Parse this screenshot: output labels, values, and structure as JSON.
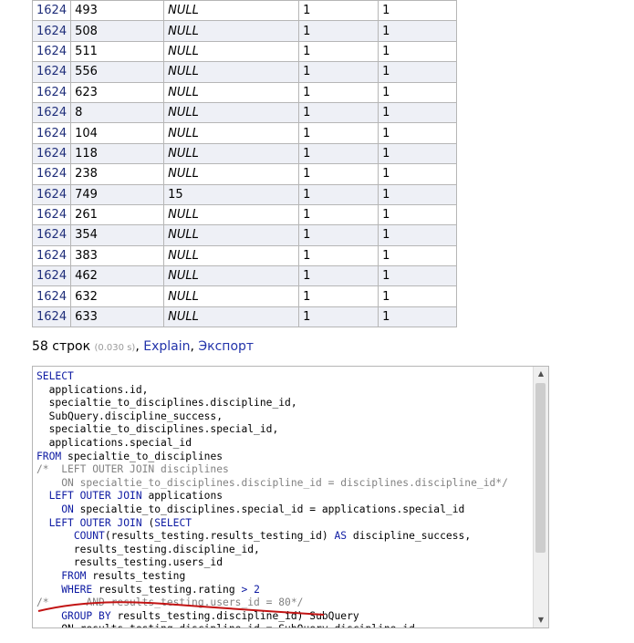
{
  "results": {
    "rows": [
      {
        "app": "1624",
        "discipline": "493",
        "success": "NULL",
        "r1": "1",
        "r2": "1"
      },
      {
        "app": "1624",
        "discipline": "508",
        "success": "NULL",
        "r1": "1",
        "r2": "1"
      },
      {
        "app": "1624",
        "discipline": "511",
        "success": "NULL",
        "r1": "1",
        "r2": "1"
      },
      {
        "app": "1624",
        "discipline": "556",
        "success": "NULL",
        "r1": "1",
        "r2": "1"
      },
      {
        "app": "1624",
        "discipline": "623",
        "success": "NULL",
        "r1": "1",
        "r2": "1"
      },
      {
        "app": "1624",
        "discipline": "8",
        "success": "NULL",
        "r1": "1",
        "r2": "1"
      },
      {
        "app": "1624",
        "discipline": "104",
        "success": "NULL",
        "r1": "1",
        "r2": "1"
      },
      {
        "app": "1624",
        "discipline": "118",
        "success": "NULL",
        "r1": "1",
        "r2": "1"
      },
      {
        "app": "1624",
        "discipline": "238",
        "success": "NULL",
        "r1": "1",
        "r2": "1"
      },
      {
        "app": "1624",
        "discipline": "749",
        "success": "15",
        "r1": "1",
        "r2": "1"
      },
      {
        "app": "1624",
        "discipline": "261",
        "success": "NULL",
        "r1": "1",
        "r2": "1"
      },
      {
        "app": "1624",
        "discipline": "354",
        "success": "NULL",
        "r1": "1",
        "r2": "1"
      },
      {
        "app": "1624",
        "discipline": "383",
        "success": "NULL",
        "r1": "1",
        "r2": "1"
      },
      {
        "app": "1624",
        "discipline": "462",
        "success": "NULL",
        "r1": "1",
        "r2": "1"
      },
      {
        "app": "1624",
        "discipline": "632",
        "success": "NULL",
        "r1": "1",
        "r2": "1"
      },
      {
        "app": "1624",
        "discipline": "633",
        "success": "NULL",
        "r1": "1",
        "r2": "1"
      }
    ]
  },
  "summary": {
    "rows_text": "58 строк",
    "time_text": "(0.030 s)",
    "separator": ",",
    "explain_label": "Explain",
    "export_label": "Экспорт"
  },
  "sql_lines": [
    [
      {
        "t": "SELECT",
        "c": "kw"
      }
    ],
    [
      {
        "t": "  applications.id,",
        "c": ""
      }
    ],
    [
      {
        "t": "  specialtie_to_disciplines.discipline_id,",
        "c": ""
      }
    ],
    [
      {
        "t": "  SubQuery.discipline_success,",
        "c": ""
      }
    ],
    [
      {
        "t": "  specialtie_to_disciplines.special_id,",
        "c": ""
      }
    ],
    [
      {
        "t": "  applications.special_id",
        "c": ""
      }
    ],
    [
      {
        "t": "FROM",
        "c": "kw"
      },
      {
        "t": " specialtie_to_disciplines",
        "c": ""
      }
    ],
    [
      {
        "t": "/*  LEFT OUTER JOIN disciplines",
        "c": "cm"
      }
    ],
    [
      {
        "t": "    ON specialtie_to_disciplines.discipline_id = disciplines.discipline_id*/",
        "c": "cm"
      }
    ],
    [
      {
        "t": "  ",
        "c": ""
      },
      {
        "t": "LEFT OUTER JOIN",
        "c": "kw"
      },
      {
        "t": " applications",
        "c": ""
      }
    ],
    [
      {
        "t": "    ",
        "c": ""
      },
      {
        "t": "ON",
        "c": "kw"
      },
      {
        "t": " specialtie_to_disciplines.special_id = applications.special_id",
        "c": ""
      }
    ],
    [
      {
        "t": "  ",
        "c": ""
      },
      {
        "t": "LEFT OUTER JOIN",
        "c": "kw"
      },
      {
        "t": " (",
        "c": ""
      },
      {
        "t": "SELECT",
        "c": "kw"
      }
    ],
    [
      {
        "t": "      ",
        "c": ""
      },
      {
        "t": "COUNT",
        "c": "kw"
      },
      {
        "t": "(results_testing.results_testing_id) ",
        "c": ""
      },
      {
        "t": "AS",
        "c": "kw"
      },
      {
        "t": " discipline_success,",
        "c": ""
      }
    ],
    [
      {
        "t": "      results_testing.discipline_id,",
        "c": ""
      }
    ],
    [
      {
        "t": "      results_testing.users_id",
        "c": ""
      }
    ],
    [
      {
        "t": "    ",
        "c": ""
      },
      {
        "t": "FROM",
        "c": "kw"
      },
      {
        "t": " results_testing",
        "c": ""
      }
    ],
    [
      {
        "t": "    ",
        "c": ""
      },
      {
        "t": "WHERE",
        "c": "kw"
      },
      {
        "t": " results_testing.rating ",
        "c": ""
      },
      {
        "t": "> 2",
        "c": "op"
      }
    ],
    [
      {
        "t": "/*      AND results_testing.users_id = 80*/",
        "c": "cm"
      }
    ],
    [
      {
        "t": "    ",
        "c": ""
      },
      {
        "t": "GROUP BY",
        "c": "kw"
      },
      {
        "t": " results_testing.discipline_id) SubQuery",
        "c": ""
      }
    ],
    [
      {
        "t": "    ON results_testing.discipline_id = SubQuery.discipline_id",
        "c": ""
      }
    ]
  ]
}
